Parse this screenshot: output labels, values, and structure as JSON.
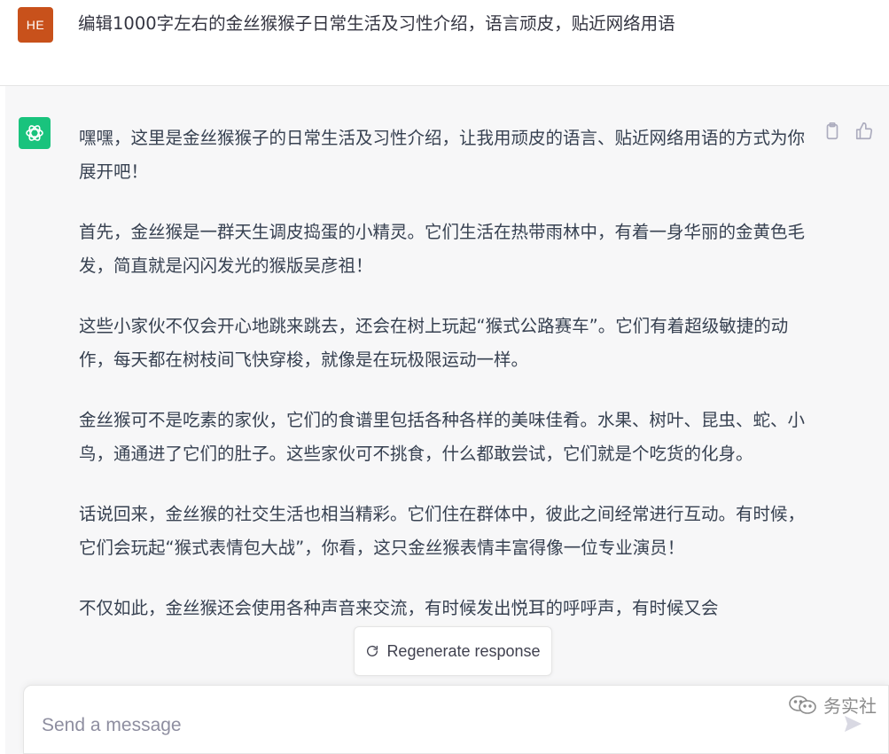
{
  "user": {
    "avatar_initials": "HE",
    "prompt": "编辑1000字左右的金丝猴猴子日常生活及习性介绍，语言顽皮，贴近网络用语"
  },
  "assistant": {
    "paragraphs": [
      "嘿嘿，这里是金丝猴猴子的日常生活及习性介绍，让我用顽皮的语言、贴近网络用语的方式为你展开吧！",
      "首先，金丝猴是一群天生调皮捣蛋的小精灵。它们生活在热带雨林中，有着一身华丽的金黄色毛发，简直就是闪闪发光的猴版吴彦祖！",
      "这些小家伙不仅会开心地跳来跳去，还会在树上玩起“猴式公路赛车”。它们有着超级敏捷的动作，每天都在树枝间飞快穿梭，就像是在玩极限运动一样。",
      "金丝猴可不是吃素的家伙，它们的食谱里包括各种各样的美味佳肴。水果、树叶、昆虫、蛇、小鸟，通通进了它们的肚子。这些家伙可不挑食，什么都敢尝试，它们就是个吃货的化身。",
      "话说回来，金丝猴的社交生活也相当精彩。它们住在群体中，彼此之间经常进行互动。有时候，它们会玩起“猴式表情包大战”，你看，这只金丝猴表情丰富得像一位专业演员！",
      "不仅如此，金丝猴还会使用各种声音来交流，有时候发出悦耳的呼呼声，有时候又会"
    ]
  },
  "regenerate_label": "Regenerate response",
  "input": {
    "placeholder": "Send a message"
  },
  "watermark": "务实社",
  "colors": {
    "user_avatar": "#c8511b",
    "bot_avatar": "#19c37d",
    "assistant_bg": "#f7f7f8"
  }
}
